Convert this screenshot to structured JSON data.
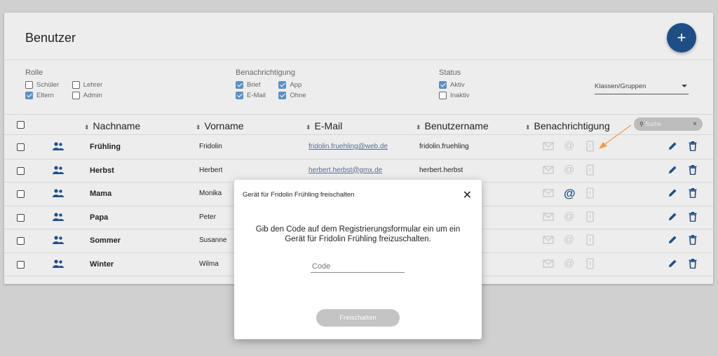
{
  "header": {
    "title": "Benutzer",
    "add_label": "+"
  },
  "filters": {
    "rolle": {
      "title": "Rolle",
      "options": [
        {
          "label": "Schüler",
          "checked": false
        },
        {
          "label": "Eltern",
          "checked": true
        },
        {
          "label": "Lehrer",
          "checked": false
        },
        {
          "label": "Admin",
          "checked": false
        }
      ]
    },
    "benachrichtigung": {
      "title": "Benachrichtigung",
      "options": [
        {
          "label": "Brief",
          "checked": true
        },
        {
          "label": "E-Mail",
          "checked": true
        },
        {
          "label": "App",
          "checked": true
        },
        {
          "label": "Ohne",
          "checked": true
        }
      ]
    },
    "status": {
      "title": "Status",
      "options": [
        {
          "label": "Aktiv",
          "checked": true
        },
        {
          "label": "Inaktiv",
          "checked": false
        }
      ]
    },
    "klassen_select": "Klassen/Gruppen"
  },
  "table": {
    "columns": [
      "Nachname",
      "Vorname",
      "E-Mail",
      "Benutzername",
      "Benachrichtigung"
    ],
    "search_placeholder": "Suche",
    "search_clear": "×",
    "rows": [
      {
        "nachname": "Frühling",
        "vorname": "Fridolin",
        "email": "fridolin.fruehling@web.de",
        "benutzername": "fridolin.fruehling"
      },
      {
        "nachname": "Herbst",
        "vorname": "Herbert",
        "email": "herbert.herbst@gmx.de",
        "benutzername": "herbert.herbst"
      },
      {
        "nachname": "Mama",
        "vorname": "Monika",
        "email": "",
        "benutzername": ""
      },
      {
        "nachname": "Papa",
        "vorname": "Peter",
        "email": "",
        "benutzername": ""
      },
      {
        "nachname": "Sommer",
        "vorname": "Susanne",
        "email": "",
        "benutzername": ""
      },
      {
        "nachname": "Winter",
        "vorname": "Wilma",
        "email": "",
        "benutzername": ""
      }
    ]
  },
  "modal": {
    "title": "Gerät für Fridolin Frühling freischalten",
    "close": "✕",
    "message": "Gib den Code auf dem Registrierungsformular ein um ein Gerät für Fridolin Frühling freizuschalten.",
    "code_placeholder": "Code",
    "button": "Freischalten"
  },
  "colors": {
    "primary": "#1d4f86",
    "checkbox": "#5b90c6",
    "arrow": "#f39a4a"
  }
}
